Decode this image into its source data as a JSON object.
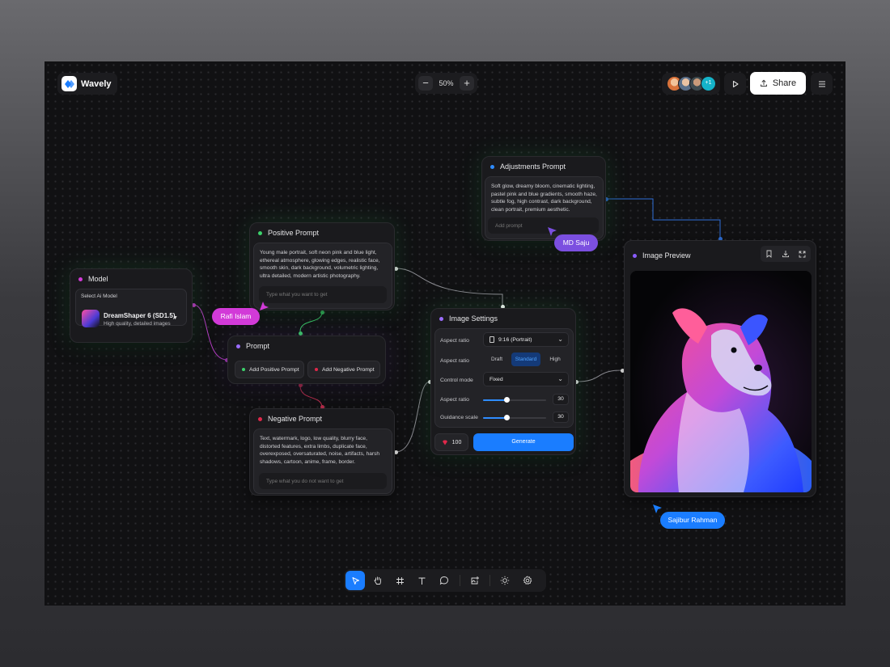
{
  "app": {
    "name": "Wavely",
    "zoom": "50%"
  },
  "collaborators": {
    "extra_count": "+1"
  },
  "toolbar": {
    "share_label": "Share"
  },
  "nodes": {
    "model": {
      "title": "Model",
      "select_label": "Select Ai Model",
      "model_name": "DreamShaper 6 (SD1.5)",
      "model_desc": "High quality, detailed images"
    },
    "positive_prompt": {
      "title": "Positive Prompt",
      "text": "Young male portrait, soft neon pink and blue light, ethereal atmosphere, glowing edges, realistic face, smooth skin, dark background, volumetric lighting, ultra detailed, modern artistic photography.",
      "placeholder": "Type what you want to get"
    },
    "prompt": {
      "title": "Prompt",
      "add_positive": "Add Positive Prompt",
      "add_negative": "Add Negative Prompt"
    },
    "negative_prompt": {
      "title": "Negative Prompt",
      "text": "Text, watermark, logo, low quality, blurry face, distorted features, extra limbs, duplicate face, overexposed, oversaturated, noise, artifacts, harsh shadows, cartoon, anime, frame, border.",
      "placeholder": "Type what you do not want to get"
    },
    "adjustments_prompt": {
      "title": "Adjustments Prompt",
      "text": "Soft glow, dreamy bloom, cinematic lighting, pastel pink and blue gradients, smooth haze, subtle fog, high contrast, dark background, clean portrait, premium aesthetic.",
      "placeholder": "Add prompt"
    },
    "image_settings": {
      "title": "Image Settings",
      "aspect_ratio_label": "Aspect ratio",
      "aspect_ratio_value": "9:16 (Portrait)",
      "quality_label": "Aspect ratio",
      "quality_options": [
        "Draft",
        "Standard",
        "High"
      ],
      "quality_selected": "Standard",
      "control_mode_label": "Control mode",
      "control_mode_value": "Fixed",
      "slider1_label": "Aspect ratio",
      "slider1_value": "30",
      "slider1_level": 0.38,
      "slider2_label": "Guidance scale",
      "slider2_value": "30",
      "slider2_level": 0.38,
      "credits": "100",
      "generate_label": "Generate"
    },
    "image_preview": {
      "title": "Image Preview"
    }
  },
  "cursors": [
    {
      "name": "Rafi Islam",
      "color": "#d23ad8"
    },
    {
      "name": "MD Saju",
      "color": "#7b4fe0"
    },
    {
      "name": "Sajibur Rahman",
      "color": "#1a7dff"
    }
  ],
  "colors": {
    "accent": "#1a7dff",
    "model_dot": "#d23ad8",
    "positive_dot": "#3cd16b",
    "prompt_dot": "#9b6cff",
    "negative_dot": "#e0284a",
    "adjust_dot": "#2f8cff",
    "settings_dot": "#9b6cff",
    "preview_dot": "#8a5cff"
  }
}
